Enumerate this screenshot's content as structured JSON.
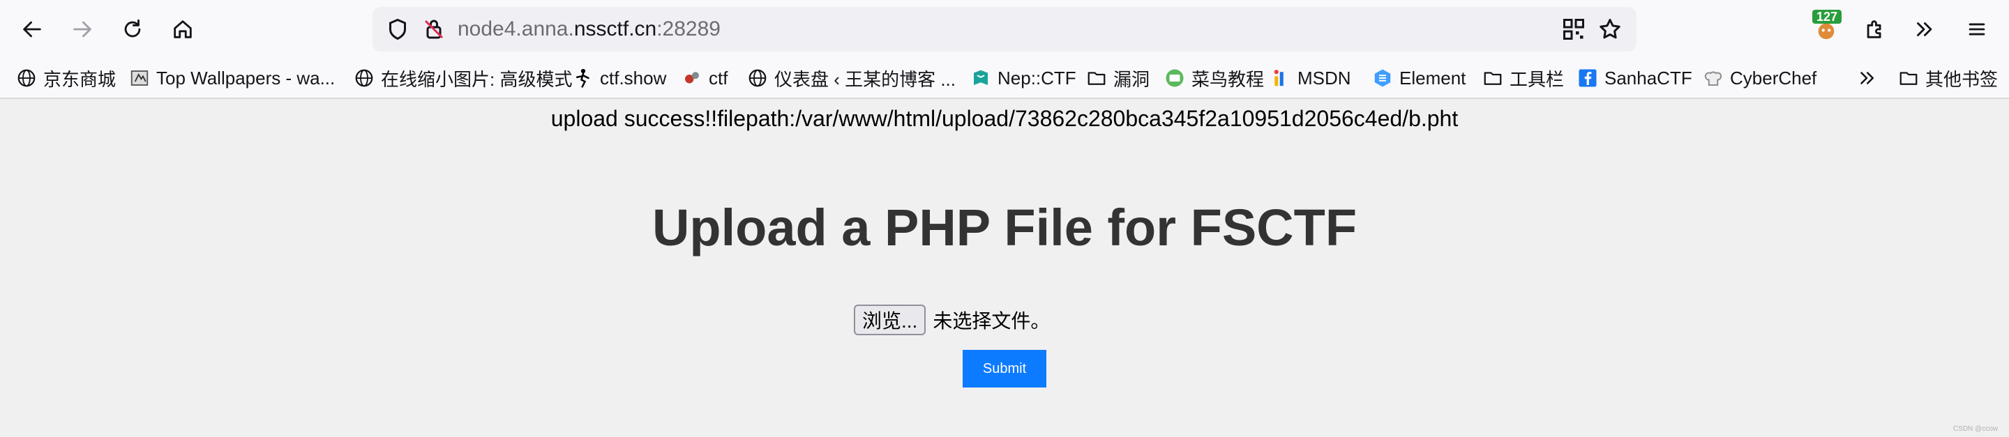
{
  "navbar": {
    "back_icon": "arrow-left-icon",
    "forward_icon": "arrow-right-icon",
    "reload_icon": "reload-icon",
    "home_icon": "home-icon",
    "url": {
      "prefix": "node4.anna.",
      "domain": "nssctf.cn",
      "suffix": ":28289"
    },
    "extension_badge": "127"
  },
  "bookmarks": [
    {
      "label": "京东商城",
      "icon": "globe-icon"
    },
    {
      "label": "Top Wallpapers - wa...",
      "icon": "wallpaper-icon"
    },
    {
      "label": "在线缩小图片: 高级模式",
      "icon": "globe-icon"
    },
    {
      "label": "ctf.show",
      "icon": "ctfshow-icon"
    },
    {
      "label": "ctf",
      "icon": "ctf-icon"
    },
    {
      "label": "仪表盘 ‹ 王某的博客 ...",
      "icon": "globe-icon"
    },
    {
      "label": "Nep::CTF",
      "icon": "nep-icon"
    },
    {
      "label": "漏洞",
      "icon": "folder-icon"
    },
    {
      "label": "菜鸟教程",
      "icon": "runoob-icon"
    },
    {
      "label": "MSDN",
      "icon": "msdn-icon"
    },
    {
      "label": "Element",
      "icon": "element-icon"
    },
    {
      "label": "工具栏",
      "icon": "folder-icon"
    },
    {
      "label": "SanhaCTF",
      "icon": "facebook-icon"
    },
    {
      "label": "CyberChef",
      "icon": "chef-icon"
    },
    {
      "label": "其他书签",
      "icon": "folder-icon"
    }
  ],
  "page": {
    "status_message": "upload success!!filepath:/var/www/html/upload/73862c280bca345f2a10951d2056c4ed/b.pht",
    "title": "Upload a PHP File for FSCTF",
    "browse_label": "浏览...",
    "no_file_text": "未选择文件。",
    "submit_label": "Submit",
    "watermark": "CSDN @ccow"
  },
  "colors": {
    "page_bg": "#f0f0f0",
    "submit_bg": "#0d7bff",
    "title_color": "#333333",
    "badge_bg": "#2a9d3b"
  }
}
